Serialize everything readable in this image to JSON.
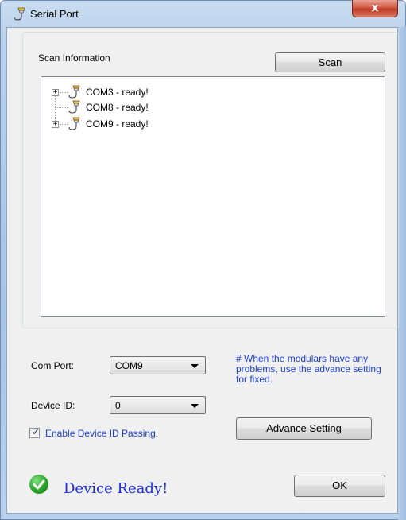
{
  "window": {
    "title": "Serial Port",
    "close_label": "x"
  },
  "scan": {
    "group_label": "Scan Information",
    "scan_button": "Scan",
    "ports": [
      {
        "label": "COM3 - ready!",
        "expandable": true
      },
      {
        "label": "COM8 - ready!",
        "expandable": false
      },
      {
        "label": "COM9 - ready!",
        "expandable": true
      }
    ]
  },
  "settings": {
    "com_port_label": "Com Port:",
    "com_port_value": "COM9",
    "device_id_label": "Device ID:",
    "device_id_value": "0",
    "enable_passing_label": "Enable Device ID Passing.",
    "enable_passing_checked": true,
    "hint": "# When the modulars have any problems, use the advance setting for fixed.",
    "advance_button": "Advance Setting"
  },
  "footer": {
    "status": "Device Ready!",
    "ok_button": "OK"
  },
  "colors": {
    "hint": "#1a3cd8",
    "status": "#1a2ed8",
    "ready_icon": "#2aa22a"
  }
}
